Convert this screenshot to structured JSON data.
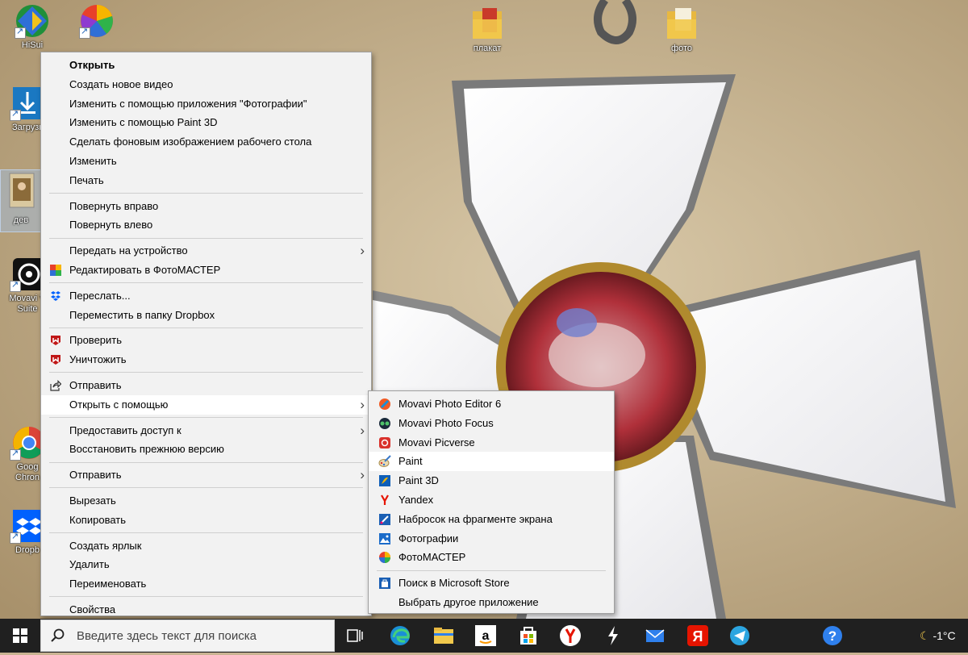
{
  "desktop": {
    "icons": [
      {
        "label": "HiSui",
        "icon": "hisuite-icon"
      },
      {
        "label": "",
        "icon": "fotomaster-icon"
      },
      {
        "label": "Загрузк",
        "icon": "downloads-icon"
      },
      {
        "label": "дев",
        "icon": "image-file-icon"
      },
      {
        "label": "Movavi V",
        "label2": "Suite",
        "icon": "movavi-suite-icon"
      },
      {
        "label": "Goog",
        "label2": "Chron",
        "icon": "chrome-icon"
      },
      {
        "label": "Dropb",
        "icon": "dropbox-icon"
      },
      {
        "label": "плакат",
        "icon": "folder-icon"
      },
      {
        "label": "фото",
        "icon": "folder-icon"
      }
    ]
  },
  "context_menu": {
    "items": [
      {
        "label": "Открыть",
        "bold": true
      },
      {
        "label": "Создать новое видео"
      },
      {
        "label": "Изменить с помощью приложения \"Фотографии\""
      },
      {
        "label": "Изменить с помощью Paint 3D"
      },
      {
        "label": "Сделать фоновым изображением рабочего стола"
      },
      {
        "label": "Изменить"
      },
      {
        "label": "Печать"
      },
      {
        "label": "Повернуть вправо"
      },
      {
        "label": "Повернуть влево"
      },
      {
        "label": "Передать на устройство",
        "submenu": true
      },
      {
        "label": "Редактировать в ФотоМАСТЕР",
        "icon": "fotomaster-icon"
      },
      {
        "label": "Переслать...",
        "icon": "dropbox-icon"
      },
      {
        "label": "Переместить в папку Dropbox"
      },
      {
        "label": "Проверить",
        "icon": "mcafee-icon"
      },
      {
        "label": "Уничтожить",
        "icon": "mcafee-icon"
      },
      {
        "label": "Отправить",
        "icon": "share-icon"
      },
      {
        "label": "Открыть с помощью",
        "submenu": true,
        "highlighted": true
      },
      {
        "label": "Предоставить доступ к",
        "submenu": true
      },
      {
        "label": "Восстановить прежнюю версию"
      },
      {
        "label": "Отправить",
        "submenu": true
      },
      {
        "label": "Вырезать"
      },
      {
        "label": "Копировать"
      },
      {
        "label": "Создать ярлык"
      },
      {
        "label": "Удалить"
      },
      {
        "label": "Переименовать"
      },
      {
        "label": "Свойства"
      }
    ],
    "submenu_arrow": "›"
  },
  "open_with_menu": {
    "items": [
      {
        "label": "Movavi Photo Editor 6",
        "icon": "movavi-photo-editor-icon"
      },
      {
        "label": "Movavi Photo Focus",
        "icon": "movavi-photo-focus-icon"
      },
      {
        "label": "Movavi Picverse",
        "icon": "movavi-picverse-icon"
      },
      {
        "label": "Paint",
        "icon": "paint-icon",
        "highlighted": true
      },
      {
        "label": "Paint 3D",
        "icon": "paint-3d-icon"
      },
      {
        "label": "Yandex",
        "icon": "yandex-icon"
      },
      {
        "label": "Набросок на фрагменте экрана",
        "icon": "snip-sketch-icon"
      },
      {
        "label": "Фотографии",
        "icon": "photos-icon"
      },
      {
        "label": "ФотоМАСТЕР",
        "icon": "fotomaster-icon"
      },
      {
        "label": "Поиск в Microsoft Store",
        "icon": "microsoft-store-icon"
      },
      {
        "label": "Выбрать другое приложение"
      }
    ]
  },
  "taskbar": {
    "search_placeholder": "Введите здесь текст для поиска",
    "apps": [
      "task-view-icon",
      "edge-icon",
      "file-explorer-icon",
      "amazon-icon",
      "microsoft-store-icon",
      "yandex-browser-icon",
      "movavi-icon",
      "mail-icon",
      "yandex-icon",
      "telegram-icon",
      "help-icon"
    ],
    "weather": "-1°C"
  },
  "colors": {
    "menu_bg": "#f2f2f2",
    "menu_highlight": "#ffffff",
    "taskbar": "#202020",
    "search_box": "#f3f3f3"
  }
}
